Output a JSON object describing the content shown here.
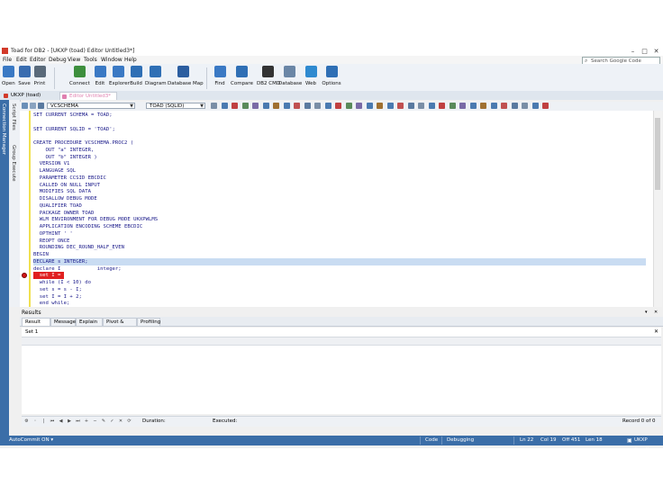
{
  "window": {
    "title": "Toad for DB2 - [UKXP (toad) Editor Untitled3*]",
    "minimize": "–",
    "maximize": "□",
    "close": "✕"
  },
  "menu": [
    "File",
    "Edit",
    "Editor",
    "Debug",
    "View",
    "Tools",
    "Window",
    "Help"
  ],
  "google_search": {
    "placeholder": "Search Google Code Search",
    "icon": "search-icon"
  },
  "toolbar": [
    {
      "label": "Open",
      "icon": "open-icon",
      "color": "#3a79c4"
    },
    {
      "label": "Save",
      "icon": "save-icon",
      "color": "#3a6db0"
    },
    {
      "label": "Print",
      "icon": "print-icon",
      "color": "#5a6a7a"
    },
    {
      "label": "Connect",
      "icon": "connect-icon",
      "color": "#3d8f3d"
    },
    {
      "label": "Edit",
      "icon": "edit-icon",
      "color": "#3a79c4"
    },
    {
      "label": "Explorer",
      "icon": "explorer-icon",
      "color": "#3a79c4"
    },
    {
      "label": "Build",
      "icon": "build-icon",
      "color": "#2f6fb5"
    },
    {
      "label": "Diagram",
      "icon": "diagram-icon",
      "color": "#2f6fb5"
    },
    {
      "label": "Database Map",
      "icon": "database-map-icon",
      "color": "#2c5ea0"
    },
    {
      "label": "Find",
      "icon": "find-icon",
      "color": "#3a79c4"
    },
    {
      "label": "Compare",
      "icon": "compare-icon",
      "color": "#2f6fb5"
    },
    {
      "label": "DB2 CMD",
      "icon": "db2-cmd-icon",
      "color": "#333333"
    },
    {
      "label": "Database",
      "icon": "database-icon",
      "color": "#6a86a6"
    },
    {
      "label": "Web",
      "icon": "web-icon",
      "color": "#2f8ad0"
    },
    {
      "label": "Options",
      "icon": "options-icon",
      "color": "#2f6fb5"
    }
  ],
  "doc_tabs": [
    {
      "label": "UKXP (toad)",
      "color": "#d23a2a",
      "active": false
    },
    {
      "label": "Editor Untitled3*",
      "color": "#e080b0",
      "active": true
    }
  ],
  "left_panels": {
    "connection_manager": "Connection Manager",
    "script_files": "Script Files",
    "group_execute": "Group Execute"
  },
  "editor_toolbar": {
    "schema": "VCSCHEMA",
    "connection": "TOAD (SQLID)"
  },
  "code_lines": [
    "SET CURRENT SCHEMA = TOAD;",
    "",
    "SET CURRENT SQLID = 'TOAD';",
    "",
    "CREATE PROCEDURE VCSCHEMA.PROC2 (",
    "    OUT \"a\" INTEGER,",
    "    OUT \"b\" INTEGER )",
    "  VERSION V1",
    "  LANGUAGE SQL",
    "  PARAMETER CCSID EBCDIC",
    "  CALLED ON NULL INPUT",
    "  MODIFIES SQL DATA",
    "  DISALLOW DEBUG MODE",
    "  QUALIFIER TOAD",
    "  PACKAGE OWNER TOAD",
    "  WLM ENVIRONMENT FOR DEBUG MODE UKXPWLMS",
    "  APPLICATION ENCODING SCHEME EBCDIC",
    "  OPTHINT ' '",
    "  REOPT ONCE",
    "  ROUNDING DEC_ROUND_HALF_EVEN",
    "BEGIN",
    "DECLARE s INTEGER;",
    "declare I            integer;",
    "  set I = 1;",
    "  while (I < 10) do",
    "  set s = s - I;",
    "  set I = I + 2;",
    "  end while;"
  ],
  "current_line": 21,
  "breakpoint_line": 23,
  "results": {
    "title": "Results",
    "tabs": [
      "Result Sets",
      "Messages",
      "Explain Plan",
      "Pivot & Chart",
      "Profiling"
    ],
    "set_tab": "Set 1",
    "duration_label": "Duration:",
    "executed_label": "Executed:",
    "record_label": "Record 0 of 0"
  },
  "status": {
    "autocommit": "AutoCommit ON ▾",
    "mode": "Code",
    "debugging": "Debugging",
    "line": "Ln 22",
    "col": "Col 19",
    "offset": "Off 451",
    "length": "Len 18",
    "connection": "UKXP (toad)"
  }
}
